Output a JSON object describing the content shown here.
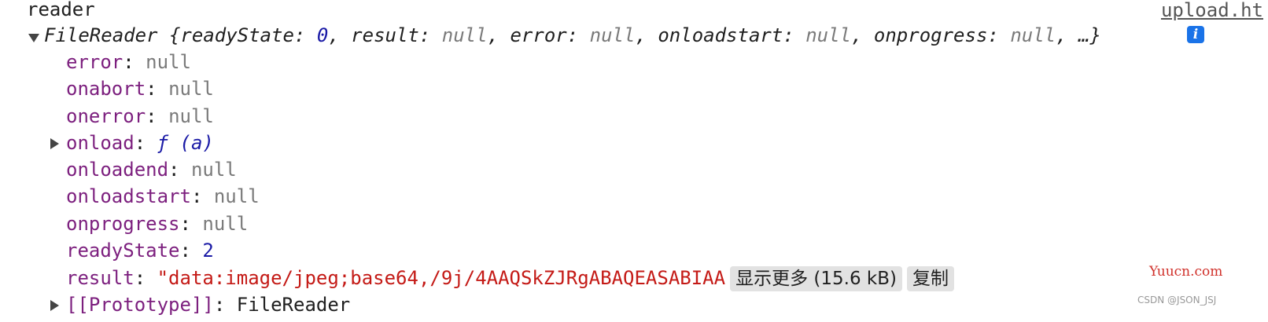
{
  "header": {
    "label": "reader",
    "source_link": "upload.ht"
  },
  "summary": {
    "class_name": "FileReader",
    "open_brace": " {",
    "props": [
      {
        "key": "readyState",
        "value": "0",
        "kind": "num"
      },
      {
        "key": "result",
        "value": "null",
        "kind": "nul"
      },
      {
        "key": "error",
        "value": "null",
        "kind": "nul"
      },
      {
        "key": "onloadstart",
        "value": "null",
        "kind": "nul"
      },
      {
        "key": "onprogress",
        "value": "null",
        "kind": "nul"
      }
    ],
    "ellipsis": ", …}",
    "info_glyph": "i"
  },
  "properties": {
    "error": {
      "key": "error",
      "value": "null"
    },
    "onabort": {
      "key": "onabort",
      "value": "null"
    },
    "onerror": {
      "key": "onerror",
      "value": "null"
    },
    "onload": {
      "key": "onload",
      "value": "ƒ (a)"
    },
    "onloadend": {
      "key": "onloadend",
      "value": "null"
    },
    "onloadstart": {
      "key": "onloadstart",
      "value": "null"
    },
    "onprogress": {
      "key": "onprogress",
      "value": "null"
    },
    "readyState": {
      "key": "readyState",
      "value": "2"
    },
    "result": {
      "key": "result",
      "value": "\"data:image/jpeg;base64,/9j/4AAQSkZJRgABAQEASABIAA",
      "show_more": "显示更多 (15.6 kB)",
      "copy": "复制"
    },
    "prototype": {
      "key": "[[Prototype]]",
      "value": "FileReader"
    }
  },
  "watermark": {
    "site": "Yuucn.com",
    "author": "CSDN @JSON_JSJ"
  },
  "colors": {
    "key": "#7c1f7e",
    "null": "#7a7a7a",
    "number": "#1a1aa6",
    "string": "#c41a16",
    "info": "#1a73e8"
  }
}
